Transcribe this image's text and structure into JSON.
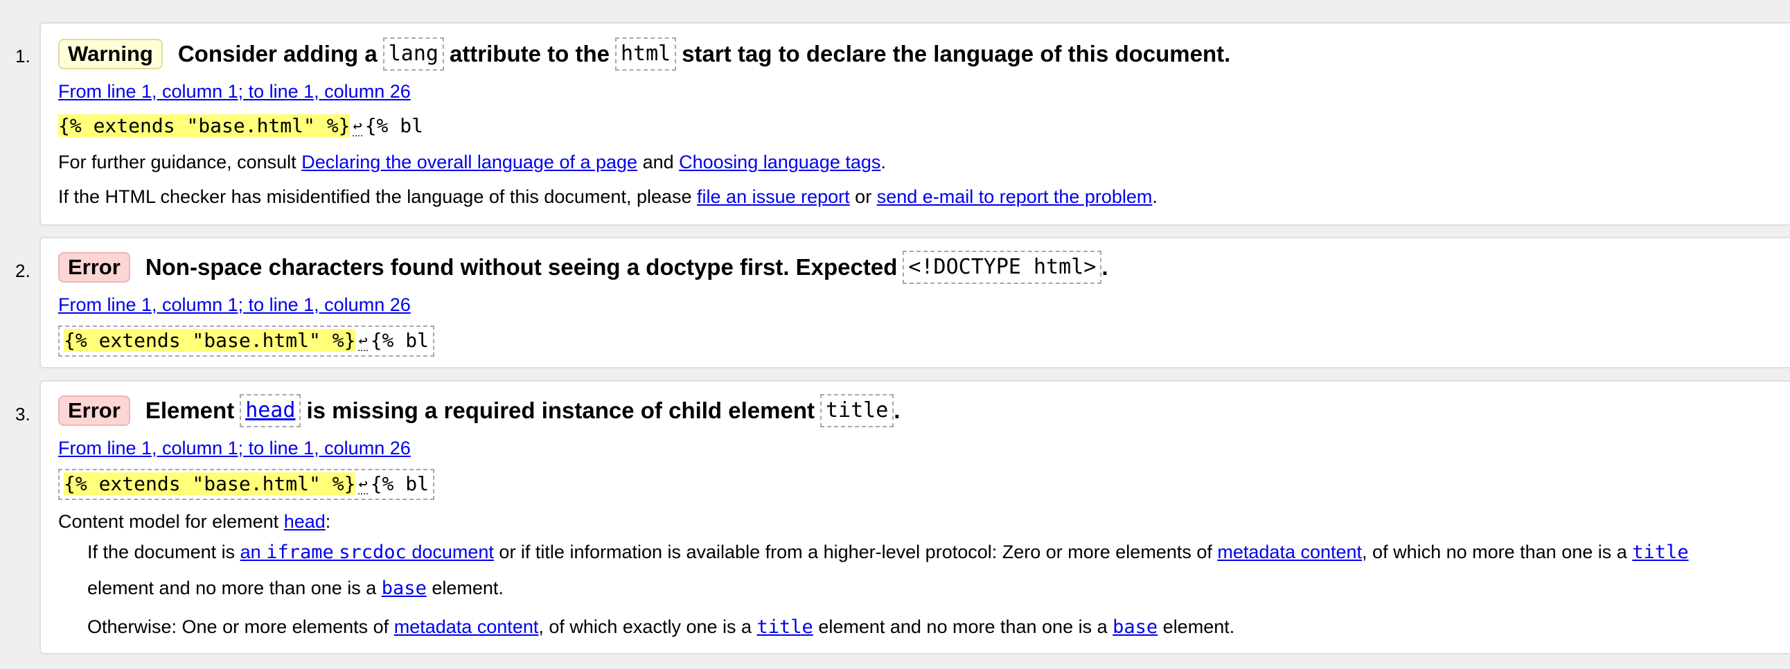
{
  "messages": [
    {
      "index": "1.",
      "badge": "Warning",
      "heading": {
        "part1": "Consider adding a",
        "code1": "lang",
        "part2": "attribute to the",
        "code2": "html",
        "part3": "start tag to declare the language of this document."
      },
      "location": "From line 1, column 1; to line 1, column 26",
      "extract": {
        "highlighted": "{% extends \"base.html\" %}",
        "linefeed": "↩",
        "rest": "{% bl"
      },
      "guidance": {
        "prefix": "For further guidance, consult",
        "link1": "Declaring the overall language of a page",
        "middle": "and",
        "link2": "Choosing language tags",
        "suffix": "."
      },
      "misidentified": {
        "prefix": "If the HTML checker has misidentified the language of this document, please",
        "link1": "file an issue report",
        "middle": "or",
        "link2": "send e-mail to report the problem",
        "suffix": "."
      }
    },
    {
      "index": "2.",
      "badge": "Error",
      "heading": {
        "part1": "Non-space characters found without seeing a doctype first. Expected",
        "code1": "<!DOCTYPE html>",
        "part2": "."
      },
      "location": "From line 1, column 1; to line 1, column 26",
      "extract": {
        "highlighted": "{% extends \"base.html\" %}",
        "linefeed": "↩",
        "rest": "{% bl"
      }
    },
    {
      "index": "3.",
      "badge": "Error",
      "heading": {
        "part1": "Element",
        "code1": "head",
        "part2": "is missing a required instance of child element",
        "code2": "title",
        "part3": "."
      },
      "location": "From line 1, column 1; to line 1, column 26",
      "extract": {
        "highlighted": "{% extends \"base.html\" %}",
        "linefeed": "↩",
        "rest": "{% bl"
      },
      "content_model": {
        "prefix": "Content model for element",
        "link": "head",
        "suffix": ":"
      },
      "para1": {
        "prefix": "If the document is",
        "link1_a": "an",
        "link1_b": "iframe",
        "link1_c": "srcdoc",
        "link1_d": "document",
        "middle1": "or if title information is available from a higher-level protocol: Zero or more elements of",
        "link2": "metadata content",
        "middle2": ", of which no more than one is a",
        "link3": "title",
        "line2_prefix": "element and no more than one is a",
        "link4": "base",
        "line2_suffix": "element."
      },
      "para2": {
        "prefix": "Otherwise: One or more elements of",
        "link1": "metadata content",
        "middle1": ", of which exactly one is a",
        "link2": "title",
        "middle2": "element and no more than one is a",
        "link3": "base",
        "suffix": "element."
      }
    }
  ],
  "colors": {
    "warning_badge": "#ffffd8",
    "error_badge": "#fcd5d5",
    "link": "#0000ee",
    "extract_highlight": "#ffff7a"
  }
}
